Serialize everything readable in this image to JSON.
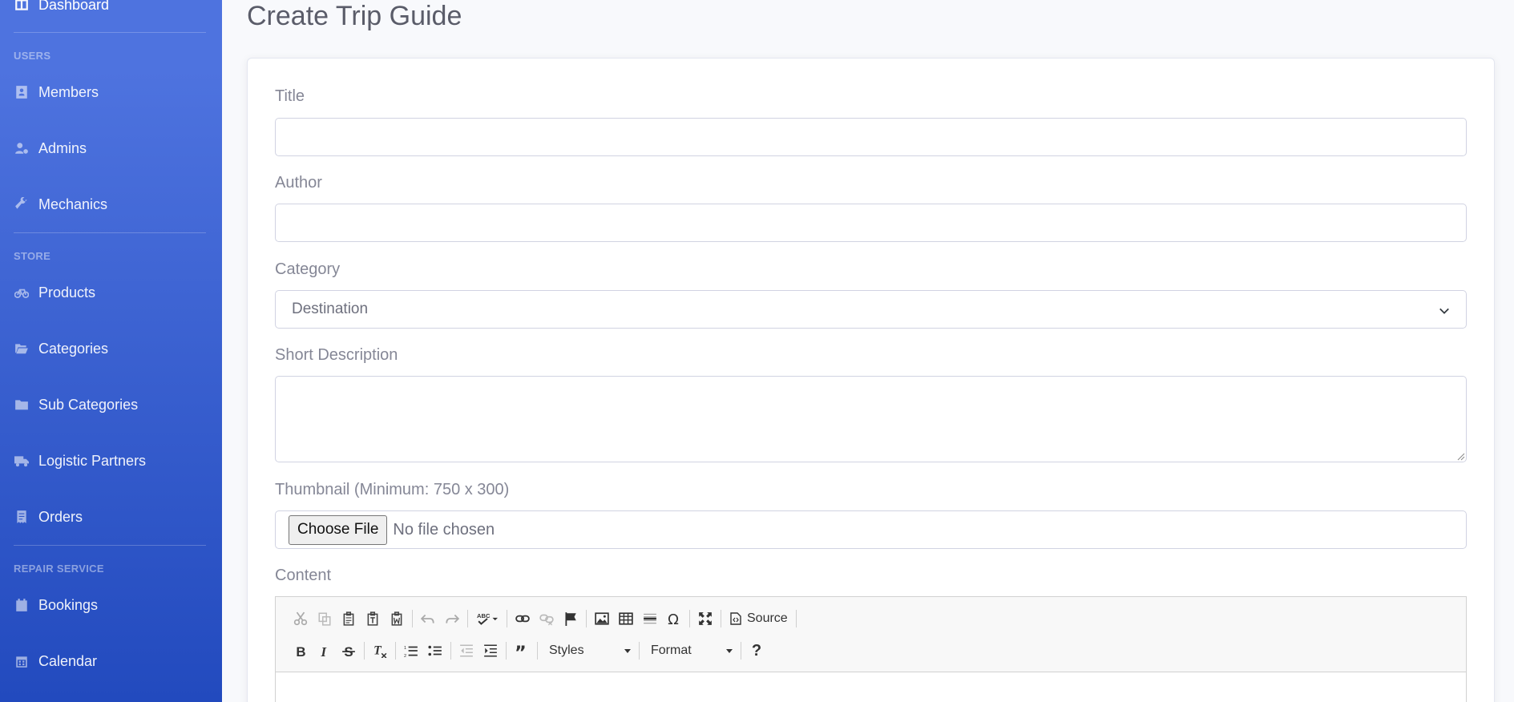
{
  "sidebar": {
    "dashboard": "Dashboard",
    "headings": {
      "users": "USERS",
      "store": "STORE",
      "repair": "REPAIR SERVICE"
    },
    "items": [
      {
        "label": "Members",
        "icon": "address-card-icon"
      },
      {
        "label": "Admins",
        "icon": "user-cog-icon"
      },
      {
        "label": "Mechanics",
        "icon": "wrench-icon"
      },
      {
        "label": "Products",
        "icon": "bicycle-icon"
      },
      {
        "label": "Categories",
        "icon": "folder-open-icon"
      },
      {
        "label": "Sub Categories",
        "icon": "folder-icon"
      },
      {
        "label": "Logistic Partners",
        "icon": "truck-icon"
      },
      {
        "label": "Orders",
        "icon": "receipt-icon"
      },
      {
        "label": "Bookings",
        "icon": "calendar-icon"
      },
      {
        "label": "Calendar",
        "icon": "calendar-alt-icon"
      }
    ]
  },
  "page": {
    "title": "Create Trip Guide"
  },
  "form": {
    "title_label": "Title",
    "title_value": "",
    "author_label": "Author",
    "author_value": "",
    "category_label": "Category",
    "category_value": "Destination",
    "short_desc_label": "Short Description",
    "short_desc_value": "",
    "thumbnail_label": "Thumbnail (Minimum: 750 x 300)",
    "file_button": "Choose File",
    "file_status": "No file chosen",
    "content_label": "Content"
  },
  "editor": {
    "source_label": "Source",
    "styles_label": "Styles",
    "format_label": "Format",
    "help_label": "?"
  },
  "colors": {
    "sidebar_top": "#4e73df",
    "sidebar_bottom": "#224abe",
    "text_muted": "#858796"
  }
}
